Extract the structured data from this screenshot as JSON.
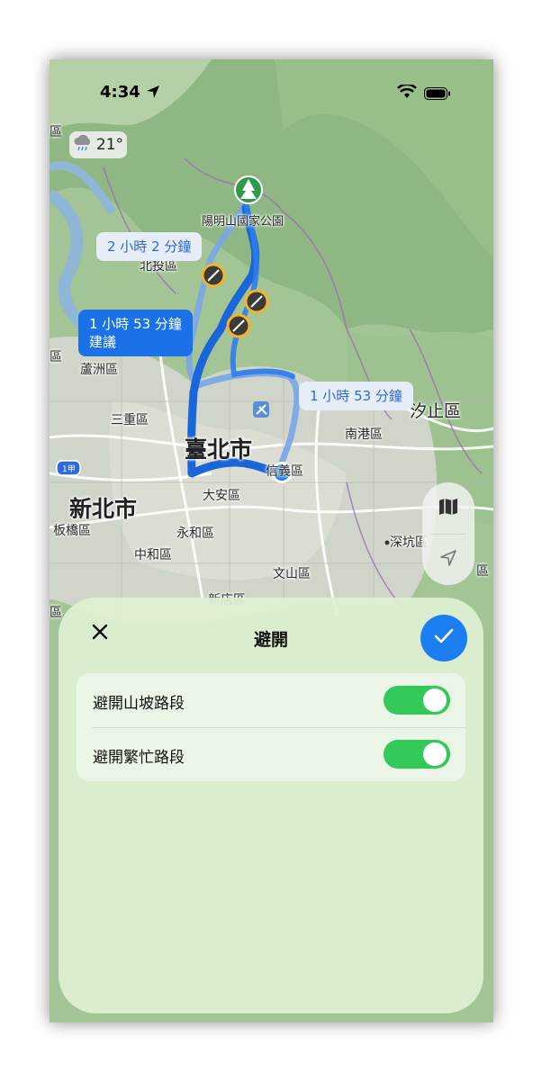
{
  "status_bar": {
    "time": "4:34"
  },
  "weather": {
    "temperature": "21°",
    "icon": "rain-cloud-icon"
  },
  "map": {
    "labels": {
      "park": "陽明山國家公園",
      "beitou": "北投區",
      "luzhou": "蘆洲區",
      "sanchong": "三重區",
      "taipei": "臺北市",
      "xinyi": "信義區",
      "daan": "大安區",
      "newtaipei": "新北市",
      "banqiao": "板橋區",
      "yonghe": "永和區",
      "zhonghe": "中和區",
      "wenshan": "文山區",
      "nangang": "南港區",
      "shenkeng": "深坑區",
      "xizhi": "汐止區",
      "highway": "1甲",
      "edge_left1": "區",
      "edge_left2": "區",
      "edge_bottom": "區",
      "edge_right": "區",
      "xindian": "新店區"
    },
    "routes": [
      {
        "duration": "2 小時 2 分鐘",
        "suggested": false
      },
      {
        "duration": "1 小時 53 分鐘",
        "note": "建議",
        "suggested": true
      },
      {
        "duration": "1 小時 53 分鐘",
        "suggested": false
      }
    ],
    "accent_color": "#1b72e8"
  },
  "map_controls": {
    "map_mode_icon": "map-icon",
    "locate_icon": "location-arrow-icon"
  },
  "sheet": {
    "title": "避開",
    "options": [
      {
        "label": "避開山坡路段",
        "enabled": true
      },
      {
        "label": "避開繁忙路段",
        "enabled": true
      }
    ],
    "toggle_color": "#34c759",
    "confirm_color": "#1b7ff2"
  }
}
